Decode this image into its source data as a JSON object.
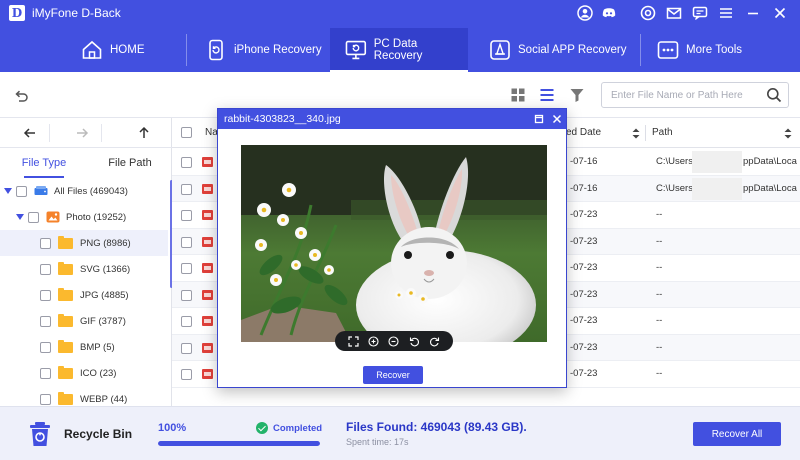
{
  "app": {
    "logo": "D",
    "title": "iMyFone D-Back"
  },
  "titlebar_icons": [
    "user-icon",
    "discord-icon",
    "settings-icon",
    "mail-icon",
    "feedback-icon",
    "menu-icon",
    "minimize-icon",
    "close-icon"
  ],
  "nav": [
    {
      "label": "HOME",
      "icon": "home-icon",
      "active": false
    },
    {
      "label": "iPhone Recovery",
      "icon": "iphone-icon",
      "active": false
    },
    {
      "label": "PC Data Recovery",
      "icon": "pc-recovery-icon",
      "active": true
    },
    {
      "label": "Social APP Recovery",
      "icon": "social-app-icon",
      "active": false
    },
    {
      "label": "More Tools",
      "icon": "more-tools-icon",
      "active": false
    }
  ],
  "toolbar": {
    "search_placeholder": "Enter File Name or Path Here",
    "view": "list"
  },
  "panel": {
    "tabs": [
      "File Type",
      "File Path"
    ],
    "active_tab": "File Type",
    "tree": [
      {
        "label": "All Files (469043)",
        "level": 0,
        "expanded": true,
        "icon": "drive-icon"
      },
      {
        "label": "Photo (19252)",
        "level": 1,
        "expanded": true,
        "icon": "photo-icon"
      },
      {
        "label": "PNG (8986)",
        "level": 2,
        "selected": true,
        "icon": "folder-icon"
      },
      {
        "label": "SVG (1366)",
        "level": 2,
        "icon": "folder-icon"
      },
      {
        "label": "JPG (4885)",
        "level": 2,
        "icon": "folder-icon"
      },
      {
        "label": "GIF (3787)",
        "level": 2,
        "icon": "folder-icon"
      },
      {
        "label": "BMP (5)",
        "level": 2,
        "icon": "folder-icon"
      },
      {
        "label": "ICO (23)",
        "level": 2,
        "icon": "folder-icon"
      },
      {
        "label": "WEBP (44)",
        "level": 2,
        "icon": "folder-icon"
      }
    ]
  },
  "table": {
    "columns": [
      "Na",
      "ed Date",
      "Path"
    ],
    "rows": [
      {
        "date": "-07-16",
        "path_start": "C:\\Users\\",
        "path_end": "ppData\\Loca"
      },
      {
        "date": "-07-16",
        "path_start": "C:\\Users\\",
        "path_end": "ppData\\Loca"
      },
      {
        "date": "-07-23",
        "path_start": "--",
        "path_end": ""
      },
      {
        "date": "-07-23",
        "path_start": "--",
        "path_end": ""
      },
      {
        "date": "-07-23",
        "path_start": "--",
        "path_end": ""
      },
      {
        "date": "-07-23",
        "path_start": "--",
        "path_end": ""
      },
      {
        "date": "-07-23",
        "path_start": "--",
        "path_end": ""
      },
      {
        "date": "-07-23",
        "path_start": "--",
        "path_end": ""
      },
      {
        "date": "-07-23",
        "path_start": "--",
        "path_end": ""
      }
    ]
  },
  "preview": {
    "filename": "rabbit-4303823__340.jpg",
    "recover_label": "Recover",
    "controls": [
      "fullscreen-icon",
      "zoom-in-icon",
      "zoom-out-icon",
      "rotate-left-icon",
      "rotate-right-icon"
    ]
  },
  "bottom": {
    "recycle_label": "Recycle Bin",
    "percent": "100%",
    "progress": 1.0,
    "status": "Completed",
    "found": "Files Found: 469043 (89.43 GB).",
    "spent": "Spent time: 17s",
    "recover_all": "Recover All"
  },
  "colors": {
    "primary": "#4250e0",
    "success": "#23b36a",
    "folder": "#fbb92e"
  }
}
